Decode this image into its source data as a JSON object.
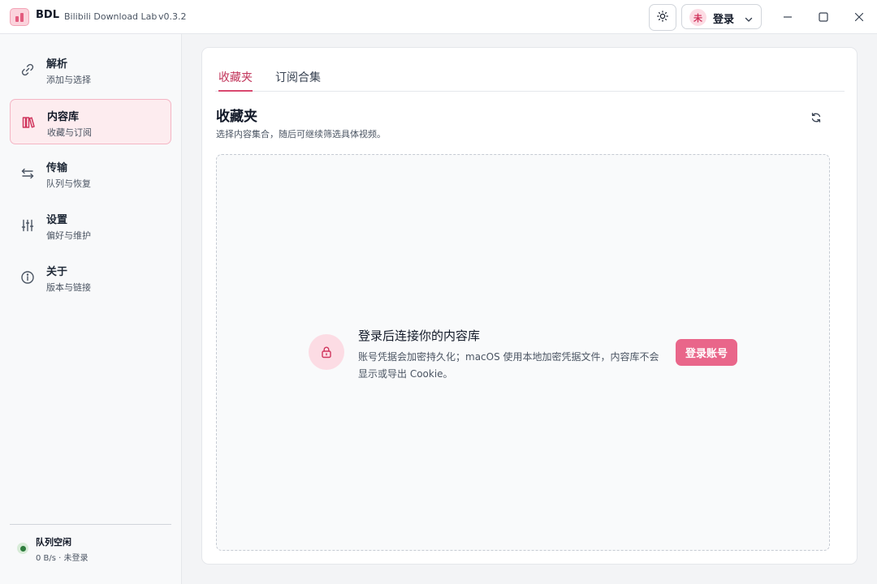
{
  "app": {
    "short_name": "BDL",
    "full_name": "Bilibili Download Lab",
    "version": "v0.3.2"
  },
  "titlebar": {
    "theme_icon": "sun-icon",
    "avatar_char": "未",
    "login_label": "登录",
    "chevron_icon": "chevron-down-icon",
    "minimize_icon": "minimize-icon",
    "maximize_icon": "maximize-icon",
    "close_icon": "close-icon"
  },
  "sidebar": {
    "items": [
      {
        "title": "解析",
        "subtitle": "添加与选择",
        "icon": "link-icon",
        "active": false
      },
      {
        "title": "内容库",
        "subtitle": "收藏与订阅",
        "icon": "library-icon",
        "active": true
      },
      {
        "title": "传输",
        "subtitle": "队列与恢复",
        "icon": "transfer-icon",
        "active": false
      },
      {
        "title": "设置",
        "subtitle": "偏好与维护",
        "icon": "sliders-icon",
        "active": false
      },
      {
        "title": "关于",
        "subtitle": "版本与链接",
        "icon": "info-icon",
        "active": false
      }
    ],
    "status": {
      "title": "队列空闲",
      "subtitle": "0 B/s · 未登录"
    }
  },
  "main": {
    "tabs": [
      {
        "label": "收藏夹",
        "active": true
      },
      {
        "label": "订阅合集",
        "active": false
      }
    ],
    "section_title": "收藏夹",
    "section_desc": "选择内容集合，随后可继续筛选具体视频。",
    "refresh_icon": "refresh-icon",
    "empty_state": {
      "icon": "lock-icon",
      "title": "登录后连接你的内容库",
      "desc": "账号凭据会加密持久化；macOS 使用本地加密凭据文件，内容库不会显示或导出 Cookie。",
      "button_label": "登录账号"
    }
  },
  "colors": {
    "accent": "#e9668a",
    "accent_text": "#c2355b",
    "accent_bg": "#fdecef",
    "status_green": "#2f7d3e"
  }
}
